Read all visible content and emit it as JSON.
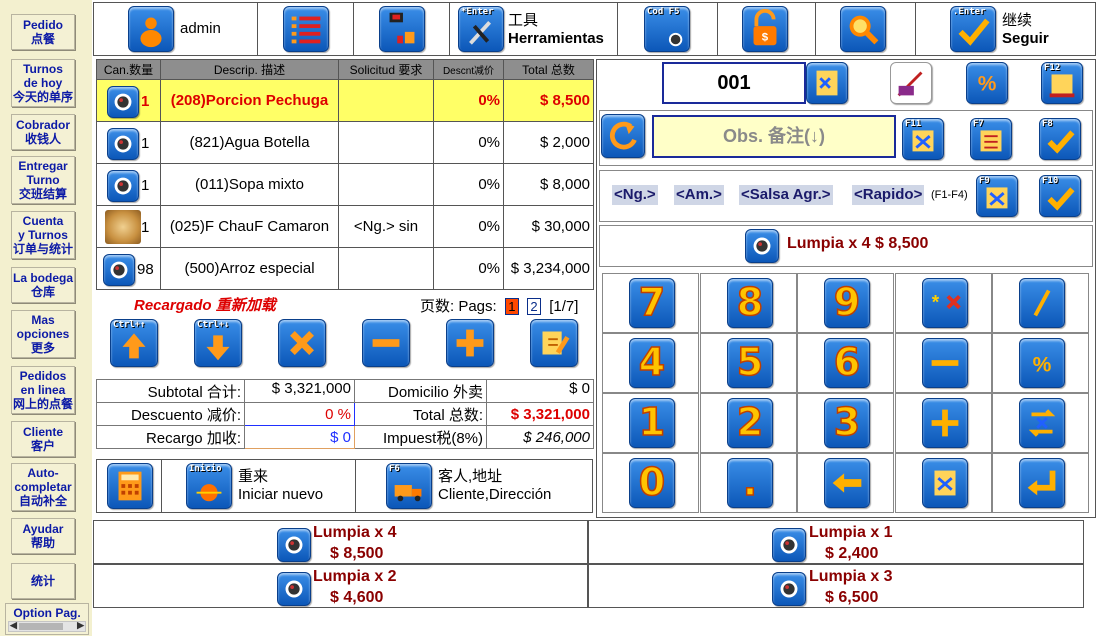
{
  "sidebar": {
    "items": [
      {
        "label": "Pedido\n点餐"
      },
      {
        "label": "Turnos\nde hoy\n今天的单序"
      },
      {
        "label": "Cobrador\n收钱人"
      },
      {
        "label": "Entregar\nTurno\n交班结算"
      },
      {
        "label": "Cuenta\ny Turnos\n订单与统计"
      },
      {
        "label": "La bodega\n仓库"
      },
      {
        "label": "Mas\nopciones\n更多"
      },
      {
        "label": "Pedidos\nen linea\n网上的点餐"
      },
      {
        "label": "Cliente\n客户"
      },
      {
        "label": "Auto-\ncompletar\n自动补全"
      },
      {
        "label": "Ayudar\n帮助"
      },
      {
        "label": "统计"
      }
    ],
    "option_page": "Option Pag."
  },
  "toolbar": {
    "user": "admin",
    "enter_key": "*Enter",
    "tools_cn": "工具",
    "tools_es": "Herramientas",
    "cod_key": "Cod F5",
    "continue_key": ".Enter",
    "continue_cn": "继续",
    "continue_es": "Seguir"
  },
  "order": {
    "headers": [
      "Can.数量",
      "Descrip. 描述",
      "Solicitud 要求",
      "Descnt减价",
      "Total 总数"
    ],
    "rows": [
      {
        "qty": "1",
        "desc": "(208)Porcion Pechuga",
        "req": "",
        "disc": "0%",
        "total": "$ 8,500",
        "selected": true
      },
      {
        "qty": "1",
        "desc": "(821)Agua Botella",
        "req": "",
        "disc": "0%",
        "total": "$ 2,000"
      },
      {
        "qty": "1",
        "desc": "(011)Sopa mixto",
        "req": "",
        "disc": "0%",
        "total": "$ 8,000"
      },
      {
        "qty": "1",
        "desc": "(025)F ChauF Camaron",
        "req": "<Ng.> sin",
        "disc": "0%",
        "total": "$ 30,000"
      },
      {
        "qty": "98",
        "desc": "(500)Arroz especial",
        "req": "",
        "disc": "0%",
        "total": "$ 3,234,000"
      }
    ]
  },
  "pagination": {
    "reload": "Recargado 重新加载",
    "label": "页数: Pags:",
    "page1": "1",
    "page2": "2",
    "info": "[1/7]"
  },
  "action_keys": {
    "up": "Ctrl+↑",
    "down": "Ctrl+↓"
  },
  "totals": {
    "subtotal_label": "Subtotal 合计:",
    "subtotal": "$ 3,321,000",
    "domicilio_label": "Domicilio 外卖",
    "domicilio": "$ 0",
    "discount_label": "Descuento 减价:",
    "discount": "0 %",
    "total_label": "Total 总数:",
    "total": "$ 3,321,000",
    "surcharge_label": "Recargo 加收:",
    "surcharge": "$ 0",
    "tax_label": "Impuest税(8%)",
    "tax": "$ 246,000"
  },
  "bottom_actions": {
    "inicio_key": "Inicio",
    "restart_cn": "重来",
    "restart_es": "Iniciar nuevo",
    "f6_key": "F6",
    "customer_cn": "客人,地址",
    "customer_es": "Cliente,Dirección"
  },
  "right_panel": {
    "table_number": "001",
    "f12_key": "F12",
    "f11_key": "F11",
    "f7_key": "F7",
    "f8_key": "F8",
    "f9_key": "F9",
    "f10_key": "F10",
    "obs": "Obs. 备注(↓)",
    "modifiers": [
      "<Ng.>",
      "<Am.>",
      "<Salsa Agr.>",
      "<Rapido>"
    ],
    "modifier_hint": "(F1-F4)",
    "last_item": "Lumpia x 4  $ 8,500"
  },
  "keypad": {
    "k7": "7",
    "k8": "8",
    "k9": "9",
    "k4": "4",
    "k5": "5",
    "k6": "6",
    "k1": "1",
    "k2": "2",
    "k3": "3",
    "k0": "0",
    "kdot": "."
  },
  "quick_items": [
    {
      "name": "Lumpia x 4",
      "price": "$ 8,500"
    },
    {
      "name": "Lumpia x 1",
      "price": "$ 2,400"
    },
    {
      "name": "Lumpia x 2",
      "price": "$ 4,600"
    },
    {
      "name": "Lumpia x 3",
      "price": "$ 6,500"
    }
  ]
}
